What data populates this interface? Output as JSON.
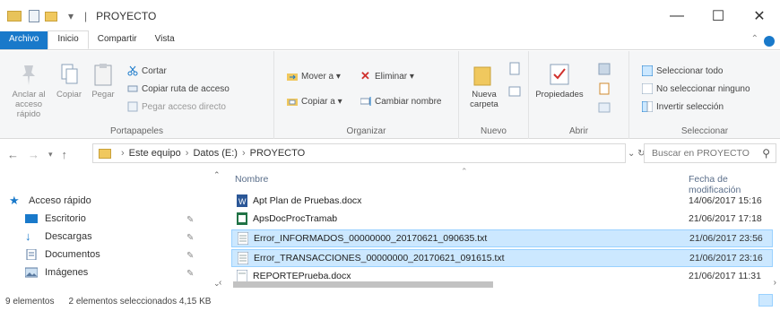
{
  "window": {
    "title": "PROYECTO",
    "minimize": "—",
    "maximize": "☐",
    "close": "✕"
  },
  "ribbon_tabs": [
    "Archivo",
    "Inicio",
    "Compartir",
    "Vista"
  ],
  "clipboard": {
    "pin_label": "Anclar al acceso rápido",
    "copy_label": "Copiar",
    "paste_label": "Pegar",
    "cut_label": "Cortar",
    "copy_path_label": "Copiar ruta de acceso",
    "paste_shortcut_label": "Pegar acceso directo",
    "group_label": "Portapapeles"
  },
  "organize": {
    "move_to": "Mover a ▾",
    "copy_to": "Copiar a ▾",
    "delete": "Eliminar ▾",
    "rename": "Cambiar nombre",
    "group_label": "Organizar"
  },
  "new": {
    "new_folder": "Nueva carpeta",
    "group_label": "Nuevo"
  },
  "open": {
    "properties": "Propiedades",
    "group_label": "Abrir"
  },
  "select": {
    "select_all": "Seleccionar todo",
    "select_none": "No seleccionar ninguno",
    "invert": "Invertir selección",
    "group_label": "Seleccionar"
  },
  "address": {
    "crumbs": [
      "Este equipo",
      "Datos (E:)",
      "PROYECTO"
    ],
    "search_placeholder": "Buscar en PROYECTO"
  },
  "navpane": {
    "items": [
      {
        "label": "Acceso rápido",
        "icon": "star-icon"
      },
      {
        "label": "Escritorio",
        "icon": "desktop-icon"
      },
      {
        "label": "Descargas",
        "icon": "download-icon"
      },
      {
        "label": "Documentos",
        "icon": "documents-icon"
      },
      {
        "label": "Imágenes",
        "icon": "pictures-icon"
      }
    ]
  },
  "filelist": {
    "col_name": "Nombre",
    "col_date": "Fecha de modificación",
    "rows": [
      {
        "name": "Apt Plan de Pruebas.docx",
        "date": "14/06/2017 15:16",
        "selected": false,
        "icon": "word-icon"
      },
      {
        "name": "ApsDocProcTramab",
        "date": "21/06/2017 17:18",
        "selected": false,
        "icon": "spreadsheet-icon"
      },
      {
        "name": "Error_INFORMADOS_00000000_20170621_090635.txt",
        "date": "21/06/2017 23:56",
        "selected": true,
        "icon": "text-file-icon"
      },
      {
        "name": "Error_TRANSACCIONES_00000000_20170621_091615.txt",
        "date": "21/06/2017 23:16",
        "selected": true,
        "icon": "text-file-icon"
      },
      {
        "name": "REPORTEPrueba.docx",
        "date": "21/06/2017 11:31",
        "selected": false,
        "icon": "text-file-icon"
      }
    ]
  },
  "status": {
    "count": "9 elementos",
    "selection": "2 elementos seleccionados  4,15 KB"
  },
  "colors": {
    "accent": "#1979ca",
    "selection_bg": "#cce8ff",
    "selection_border": "#99d1ff",
    "folder": "#f0c85e"
  }
}
